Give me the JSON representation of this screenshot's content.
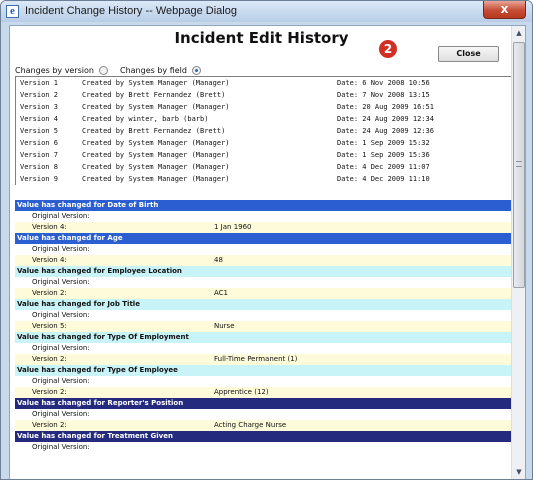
{
  "window": {
    "title": "Incident Change History -- Webpage Dialog",
    "close_glyph": "x",
    "app_icon": "ie-icon"
  },
  "page": {
    "heading": "Incident Edit History",
    "badge": "2",
    "close_button": "Close"
  },
  "view_options": {
    "by_version_label": "Changes by version",
    "by_field_label": "Changes by field",
    "selected": "by_field"
  },
  "versions": [
    {
      "version": "Version 1",
      "created_by": "Created by System Manager (Manager)",
      "date": "Date: 6 Nov 2008 10:56"
    },
    {
      "version": "Version 2",
      "created_by": "Created by Brett Fernandez (Brett)",
      "date": "Date: 7 Nov 2008 13:15"
    },
    {
      "version": "Version 3",
      "created_by": "Created by System Manager (Manager)",
      "date": "Date: 20 Aug 2009 16:51"
    },
    {
      "version": "Version 4",
      "created_by": "Created by winter, barb (barb)",
      "date": "Date: 24 Aug 2009 12:34"
    },
    {
      "version": "Version 5",
      "created_by": "Created by Brett Fernandez (Brett)",
      "date": "Date: 24 Aug 2009 12:36"
    },
    {
      "version": "Version 6",
      "created_by": "Created by System Manager (Manager)",
      "date": "Date: 1 Sep 2009 15:32"
    },
    {
      "version": "Version 7",
      "created_by": "Created by System Manager (Manager)",
      "date": "Date: 1 Sep 2009 15:36"
    },
    {
      "version": "Version 8",
      "created_by": "Created by System Manager (Manager)",
      "date": "Date: 4 Dec 2009 11:07"
    },
    {
      "version": "Version 9",
      "created_by": "Created by System Manager (Manager)",
      "date": "Date: 4 Dec 2009 11:10"
    }
  ],
  "changes": [
    {
      "header": "Value has changed for Date of Birth",
      "style": "blue",
      "original_label": "Original Version:",
      "version_label": "Version 4:",
      "value": "1 Jan 1960"
    },
    {
      "header": "Value has changed for Age",
      "style": "blue",
      "original_label": "Original Version:",
      "version_label": "Version 4:",
      "value": "48"
    },
    {
      "header": "Value has changed for Employee Location",
      "style": "cyan",
      "original_label": "Original Version:",
      "version_label": "Version 2:",
      "value": "AC1"
    },
    {
      "header": "Value has changed for Job Title",
      "style": "cyan",
      "original_label": "Original Version:",
      "version_label": "Version 5:",
      "value": "Nurse"
    },
    {
      "header": "Value has changed for Type Of Employment",
      "style": "cyan",
      "original_label": "Original Version:",
      "version_label": "Version 2:",
      "value": "Full-Time Permanent (1)"
    },
    {
      "header": "Value has changed for Type Of Employee",
      "style": "cyan",
      "original_label": "Original Version:",
      "version_label": "Version 2:",
      "value": "Apprentice (12)"
    },
    {
      "header": "Value has changed for Reporter's Position",
      "style": "navy",
      "original_label": "Original Version:",
      "version_label": "Version 2:",
      "value": "Acting Charge Nurse"
    },
    {
      "header": "Value has changed for Treatment Given",
      "style": "navy",
      "original_label": "Original Version:",
      "version_label": "",
      "value": ""
    }
  ],
  "colors": {
    "blue_header": "#2a5ed1",
    "cyan_header": "#c8f4f8",
    "navy_header": "#242a7e",
    "version_row": "#fdfbd9",
    "badge": "#d12f24"
  }
}
